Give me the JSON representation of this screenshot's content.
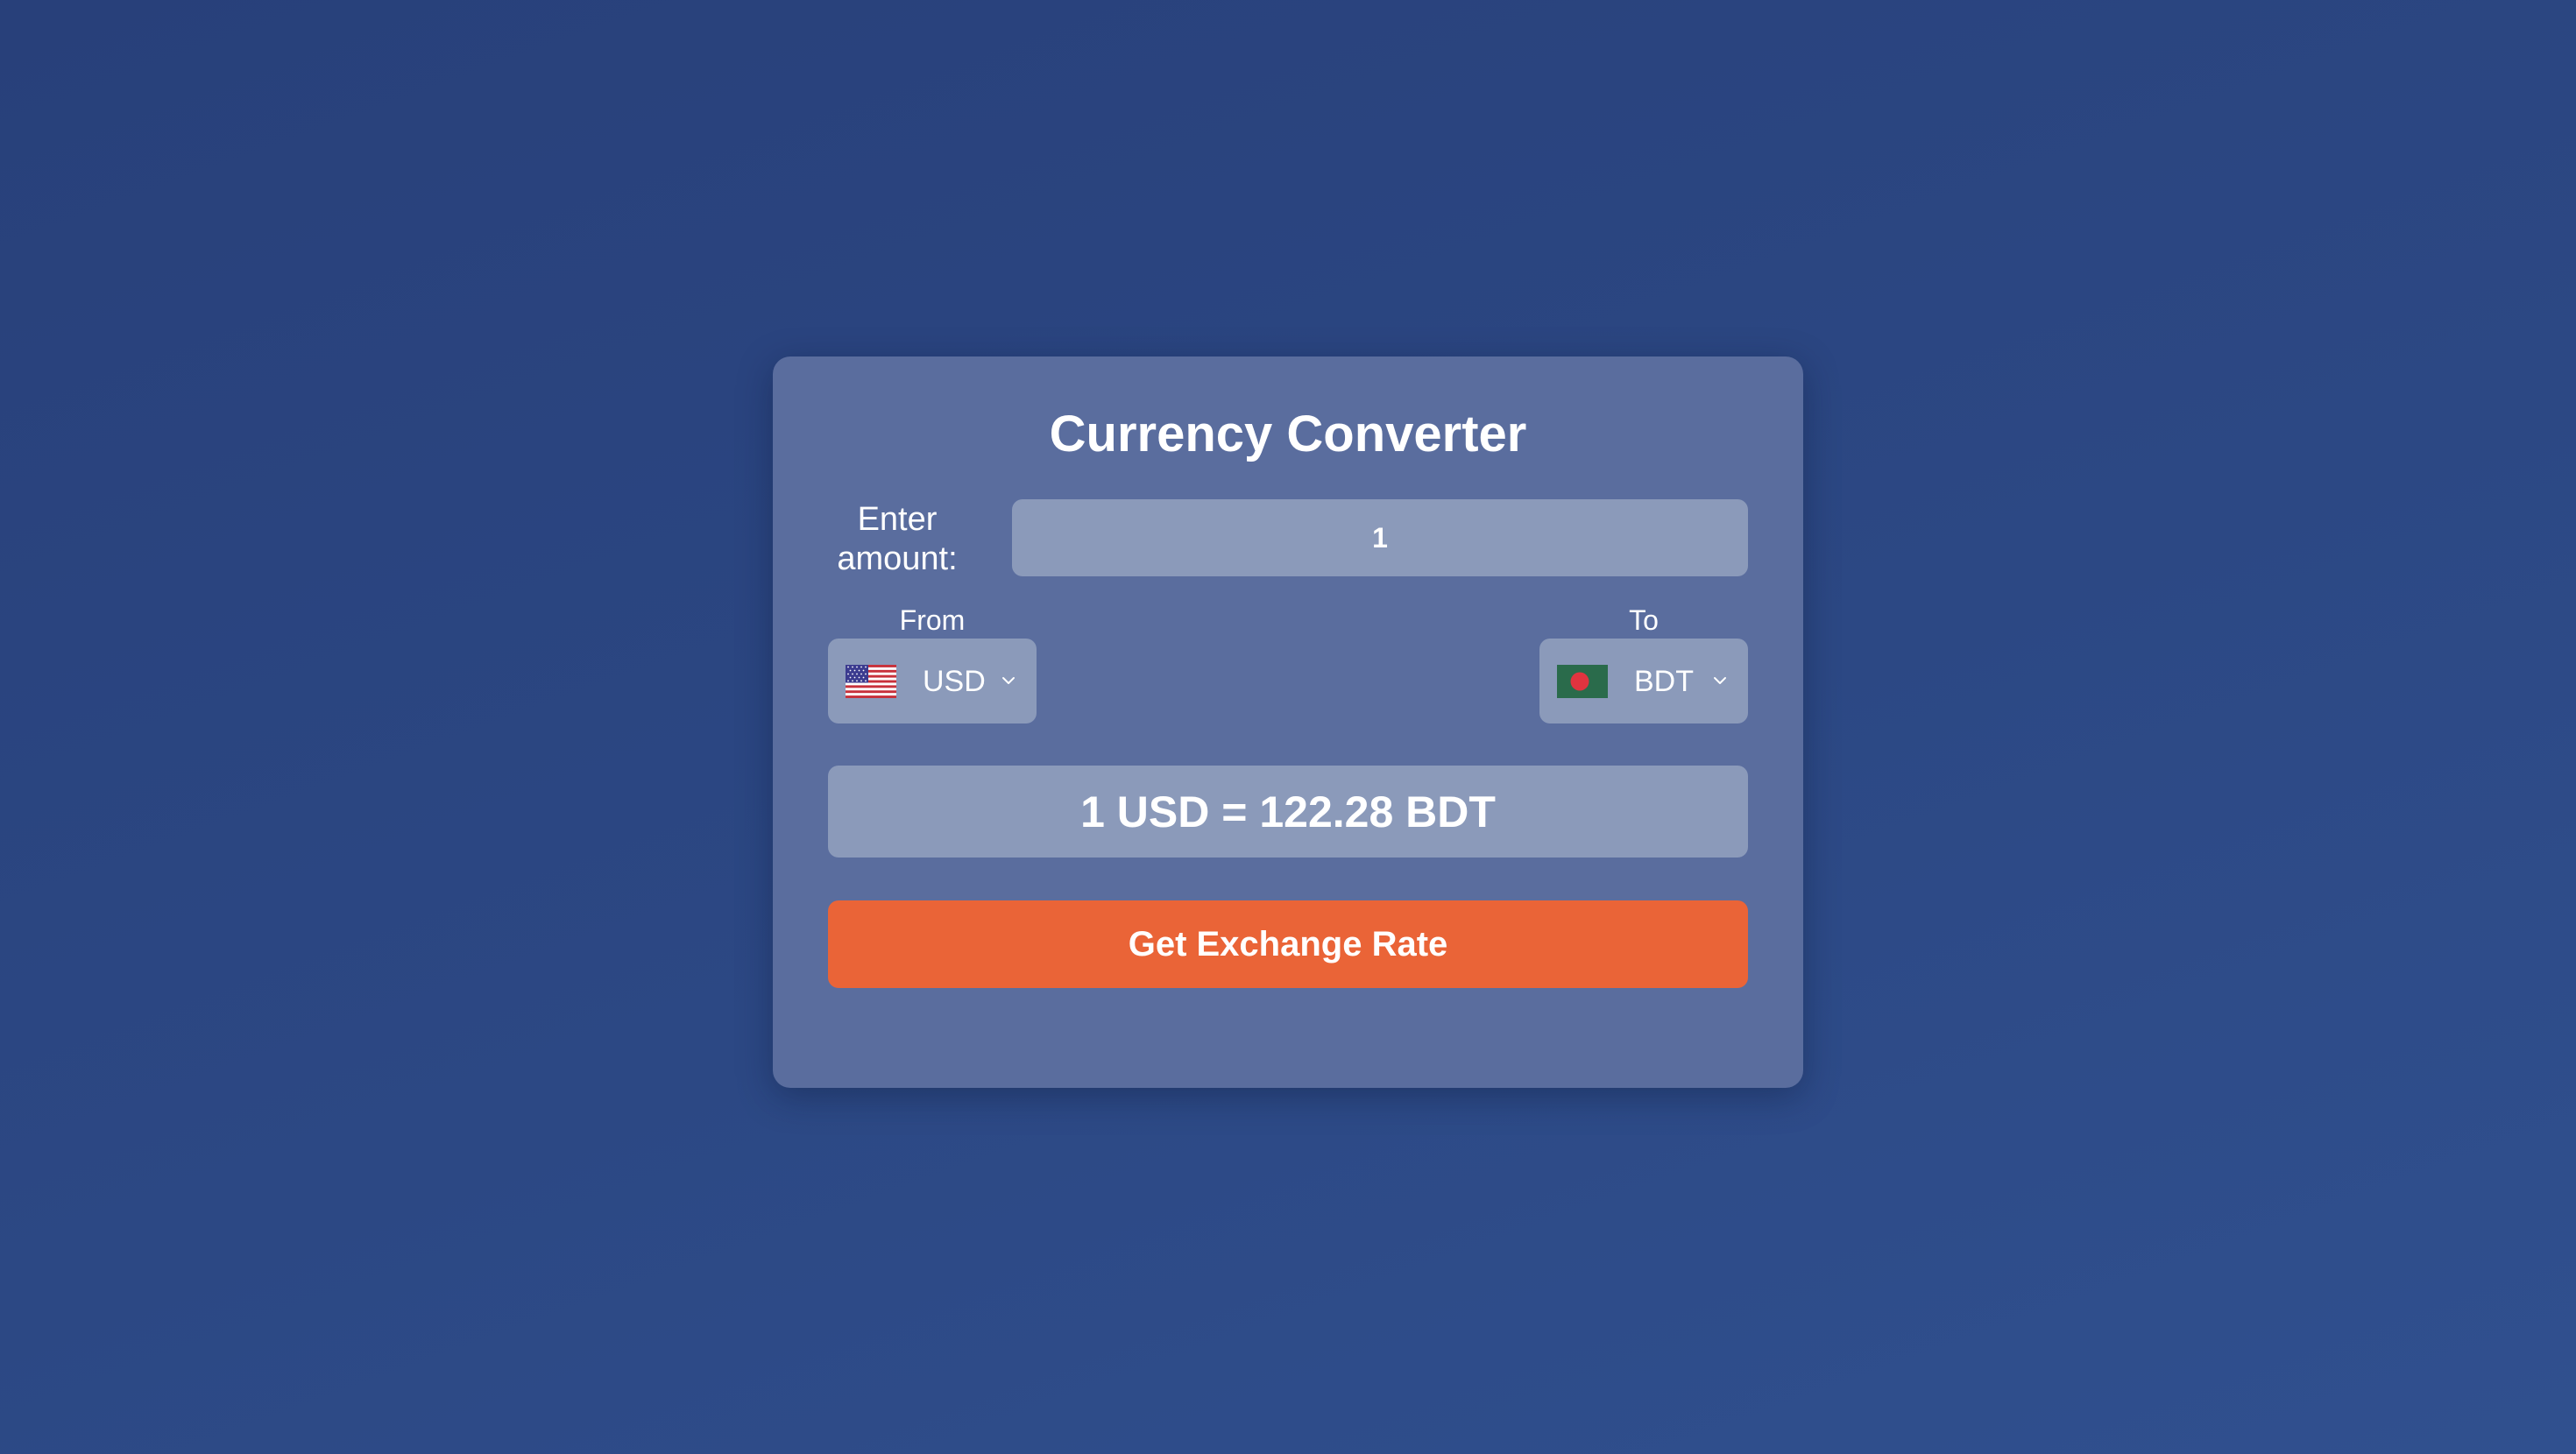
{
  "converter": {
    "title": "Currency Converter",
    "amount_label": "Enter amount:",
    "amount_value": "1",
    "from": {
      "label": "From",
      "currency": "USD",
      "flag_icon": "us-flag-icon"
    },
    "to": {
      "label": "To",
      "currency": "BDT",
      "flag_icon": "bangladesh-flag-icon"
    },
    "result_text": "1 USD = 122.28 BDT",
    "button_label": "Get Exchange Rate"
  },
  "colors": {
    "background": "#2c4884",
    "card": "#5a6d9e",
    "field": "#8b9aba",
    "button": "#ea6437",
    "text": "#ffffff"
  }
}
